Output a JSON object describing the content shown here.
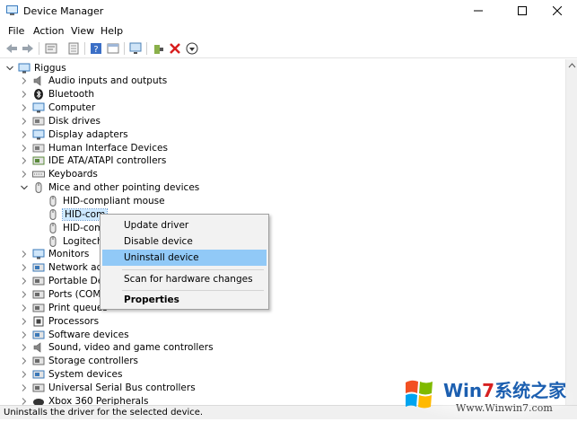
{
  "window": {
    "title": "Device Manager"
  },
  "menu": [
    "File",
    "Action",
    "View",
    "Help"
  ],
  "toolbar_icons": [
    "back-arrow-icon",
    "forward-arrow-icon",
    "properties-icon",
    "show-hidden-icon",
    "help-icon",
    "window-icon",
    "monitor-scan-icon",
    "add-driver-icon",
    "uninstall-x-icon",
    "download-icon"
  ],
  "tree": {
    "root": "Riggus",
    "items": [
      {
        "label": "Audio inputs and outputs",
        "icon": "speaker-icon",
        "level": 1,
        "expanded": false
      },
      {
        "label": "Bluetooth",
        "icon": "bluetooth-icon",
        "level": 1,
        "expanded": false
      },
      {
        "label": "Computer",
        "icon": "computer-icon",
        "level": 1,
        "expanded": false
      },
      {
        "label": "Disk drives",
        "icon": "disk-icon",
        "level": 1,
        "expanded": false
      },
      {
        "label": "Display adapters",
        "icon": "display-icon",
        "level": 1,
        "expanded": false
      },
      {
        "label": "Human Interface Devices",
        "icon": "hid-icon",
        "level": 1,
        "expanded": false
      },
      {
        "label": "IDE ATA/ATAPI controllers",
        "icon": "ide-icon",
        "level": 1,
        "expanded": false
      },
      {
        "label": "Keyboards",
        "icon": "keyboard-icon",
        "level": 1,
        "expanded": false
      },
      {
        "label": "Mice and other pointing devices",
        "icon": "mouse-icon",
        "level": 1,
        "expanded": true
      },
      {
        "label": "HID-compliant mouse",
        "icon": "mouse-icon",
        "level": 2
      },
      {
        "label": "HID-com",
        "icon": "mouse-icon",
        "level": 2,
        "selected": true
      },
      {
        "label": "HID-com",
        "icon": "mouse-icon",
        "level": 2
      },
      {
        "label": "Logitech",
        "icon": "mouse-icon",
        "level": 2
      },
      {
        "label": "Monitors",
        "icon": "monitor-icon",
        "level": 1,
        "expanded": false
      },
      {
        "label": "Network ada",
        "icon": "network-icon",
        "level": 1,
        "expanded": false
      },
      {
        "label": "Portable Dev",
        "icon": "portable-icon",
        "level": 1,
        "expanded": false
      },
      {
        "label": "Ports (COM &",
        "icon": "port-icon",
        "level": 1,
        "expanded": false
      },
      {
        "label": "Print queues",
        "icon": "printer-icon",
        "level": 1,
        "expanded": false
      },
      {
        "label": "Processors",
        "icon": "processor-icon",
        "level": 1,
        "expanded": false
      },
      {
        "label": "Software devices",
        "icon": "software-icon",
        "level": 1,
        "expanded": false
      },
      {
        "label": "Sound, video and game controllers",
        "icon": "sound-icon",
        "level": 1,
        "expanded": false
      },
      {
        "label": "Storage controllers",
        "icon": "storage-icon",
        "level": 1,
        "expanded": false
      },
      {
        "label": "System devices",
        "icon": "system-icon",
        "level": 1,
        "expanded": false
      },
      {
        "label": "Universal Serial Bus controllers",
        "icon": "usb-icon",
        "level": 1,
        "expanded": false
      },
      {
        "label": "Xbox 360 Peripherals",
        "icon": "xbox-icon",
        "level": 1,
        "expanded": false
      }
    ]
  },
  "context_menu": {
    "items": [
      {
        "label": "Update driver",
        "highlighted": false,
        "bold": false
      },
      {
        "label": "Disable device",
        "highlighted": false,
        "bold": false
      },
      {
        "label": "Uninstall device",
        "highlighted": true,
        "bold": false
      },
      {
        "label": "Scan for hardware changes",
        "highlighted": false,
        "bold": false
      },
      {
        "label": "Properties",
        "highlighted": false,
        "bold": true
      }
    ]
  },
  "status": {
    "text": "Uninstalls the driver for the selected device."
  },
  "watermark": {
    "brand_prefix": "Win",
    "brand_digit": "7",
    "brand_suffix": "系统之家",
    "url": "Www.Winwin7.com"
  },
  "colors": {
    "selection": "#cce8ff",
    "menu_highlight": "#91c9f7",
    "status_bg": "#f0f0f0"
  }
}
